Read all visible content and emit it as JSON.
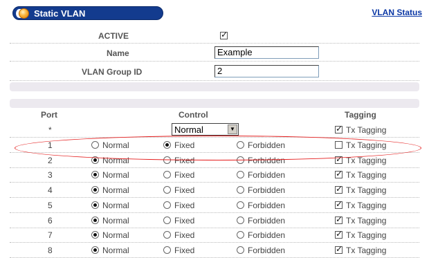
{
  "header": {
    "title": "Static VLAN",
    "status_link": "VLAN Status"
  },
  "form": {
    "active_label": "ACTIVE",
    "active_checked": true,
    "name_label": "Name",
    "name_value": "Example",
    "group_id_label": "VLAN Group ID",
    "group_id_value": "2"
  },
  "table": {
    "headers": {
      "port": "Port",
      "control": "Control",
      "tagging": "Tagging"
    },
    "all_row": {
      "port": "*",
      "control_select": "Normal",
      "tx_label": "Tx Tagging",
      "tx_checked": true
    },
    "option_labels": [
      "Normal",
      "Fixed",
      "Forbidden"
    ],
    "tx_label": "Tx Tagging",
    "rows": [
      {
        "port": "1",
        "control": "Fixed",
        "tx_checked": false
      },
      {
        "port": "2",
        "control": "Normal",
        "tx_checked": true
      },
      {
        "port": "3",
        "control": "Normal",
        "tx_checked": true
      },
      {
        "port": "4",
        "control": "Normal",
        "tx_checked": true
      },
      {
        "port": "5",
        "control": "Normal",
        "tx_checked": true
      },
      {
        "port": "6",
        "control": "Normal",
        "tx_checked": true
      },
      {
        "port": "7",
        "control": "Normal",
        "tx_checked": true
      },
      {
        "port": "8",
        "control": "Normal",
        "tx_checked": true
      }
    ]
  },
  "colors": {
    "header_bg": "#133b8e",
    "link": "#0a37a5",
    "highlight": "#e52020"
  }
}
